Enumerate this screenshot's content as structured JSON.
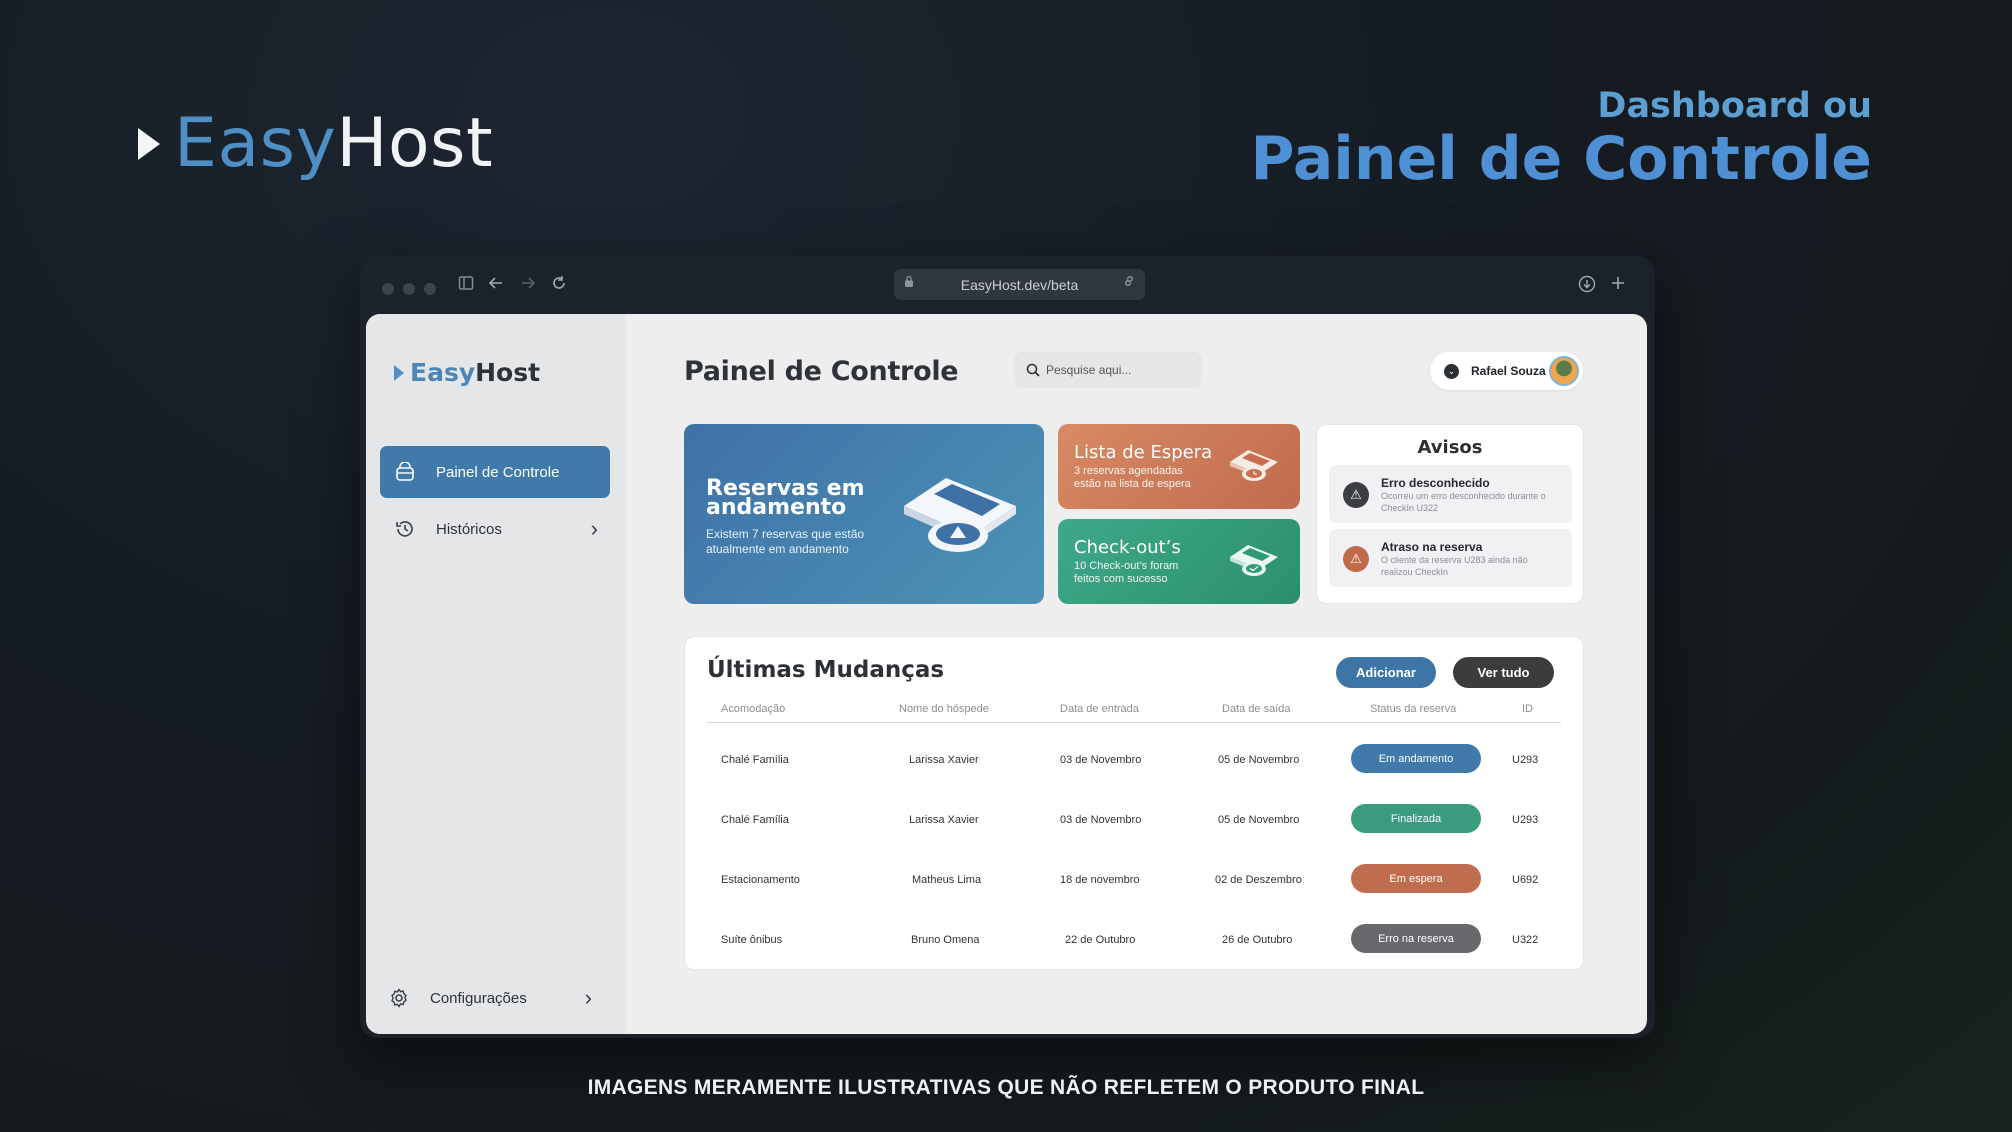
{
  "hero": {
    "logo_easy": "Easy",
    "logo_host": "Host",
    "subtitle": "Dashboard ou",
    "title": "Painel de Controle",
    "footnote": "IMAGENS MERAMENTE ILUSTRATIVAS QUE NÃO REFLETEM O PRODUTO FINAL"
  },
  "browser": {
    "url": "EasyHost.dev/beta",
    "icons": [
      "sidebar-toggle-icon",
      "back-arrow-icon",
      "forward-arrow-icon",
      "reload-icon",
      "lock-icon",
      "link-icon",
      "download-icon",
      "new-tab-icon"
    ]
  },
  "sidebar": {
    "logo_easy": "Easy",
    "logo_host": "Host",
    "items": [
      {
        "label": "Painel de Controle",
        "icon": "bag-icon",
        "active": true
      },
      {
        "label": "Históricos",
        "icon": "history-icon",
        "active": false
      }
    ],
    "settings_label": "Configurações"
  },
  "header": {
    "title": "Painel de Controle",
    "search_placeholder": "Pesquise aqui...",
    "user_name": "Rafael Souza"
  },
  "cards": {
    "reservas": {
      "title": "Reservas em andamento",
      "desc": "Existem 7 reservas que estão atualmente em andamento"
    },
    "espera": {
      "title": "Lista de Espera",
      "desc": "3 reservas agendadas estão na lista de espera"
    },
    "checkout": {
      "title": "Check-out’s",
      "desc": "10 Check-out’s foram feitos com sucesso"
    }
  },
  "avisos": {
    "title": "Avisos",
    "items": [
      {
        "title": "Erro desconhecido",
        "desc": "Ocorreu um erro desconhecido durante o CheckIn U322",
        "color": "#3b3f44"
      },
      {
        "title": "Atraso na reserva",
        "desc": "O cliente da reserva U283 ainda não realizou CheckIn",
        "color": "#c06a4c"
      }
    ]
  },
  "changes": {
    "title": "Últimas Mudanças",
    "add_label": "Adicionar",
    "view_all_label": "Ver tudo",
    "headers": [
      "Acomodação",
      "Nome do hóspede",
      "Data de entrada",
      "Data de saída",
      "Status da reserva",
      "ID"
    ],
    "rows": [
      {
        "acomodacao": "Chalé Família",
        "hospede": "Larissa Xavier",
        "entrada": "03 de Novembro",
        "saida": "05 de Novembro",
        "status": "Em andamento",
        "status_color": "#3f7aaa",
        "id": "U293"
      },
      {
        "acomodacao": "Chalé Família",
        "hospede": "Larissa Xavier",
        "entrada": "03 de Novembro",
        "saida": "05 de Novembro",
        "status": "Finalizada",
        "status_color": "#3a9b7f",
        "id": "U293"
      },
      {
        "acomodacao": "Estacionamento",
        "hospede": "Matheus Lima",
        "entrada": "18 de novembro",
        "saida": "02 de Deszembro",
        "status": "Em espera",
        "status_color": "#c06c4e",
        "id": "U692"
      },
      {
        "acomodacao": "Suíte ônibus",
        "hospede": "Bruno Omena",
        "entrada": "22 de Outubro",
        "saida": "26 de Outubro",
        "status": "Erro na reserva",
        "status_color": "#66686b",
        "id": "U322"
      }
    ]
  },
  "colors": {
    "accent": "#3f7aaa",
    "orange": "#c96f4f",
    "green": "#2f9a74"
  }
}
